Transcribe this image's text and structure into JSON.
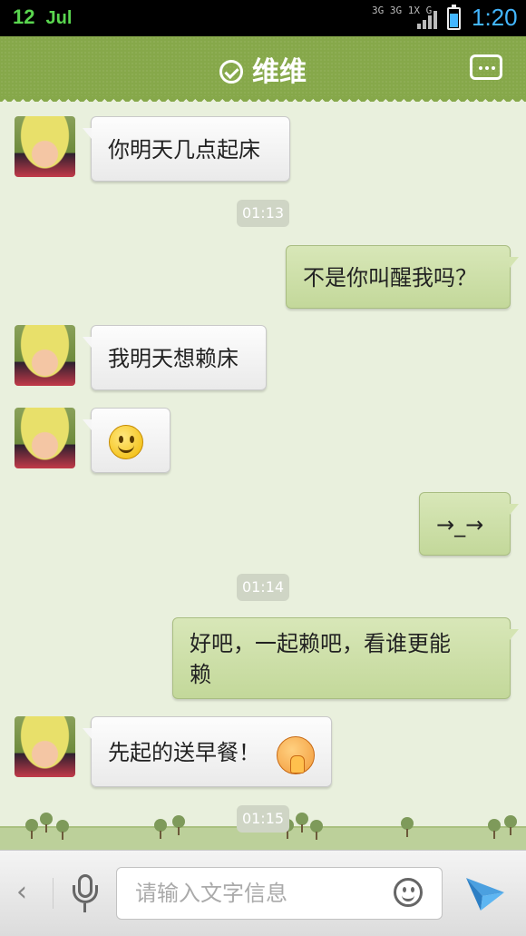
{
  "status_bar": {
    "day": "12",
    "month": "Jul",
    "network_top": "3G 3G 1X G",
    "time": "1:20"
  },
  "header": {
    "contact_name": "维维"
  },
  "messages": [
    {
      "from": "contact",
      "text": "你明天几点起床"
    },
    {
      "timestamp": "01:13"
    },
    {
      "from": "me",
      "text": "不是你叫醒我吗？"
    },
    {
      "from": "contact",
      "text": "我明天想赖床"
    },
    {
      "from": "contact",
      "emoji": "smile-emoji"
    },
    {
      "from": "me",
      "text": "→_→"
    },
    {
      "timestamp": "01:14"
    },
    {
      "from": "me",
      "text": "好吧，一起赖吧，看谁更能",
      "text_line2": "赖"
    },
    {
      "from": "contact",
      "text": "先起的送早餐！",
      "emoji": "praying-emoji"
    },
    {
      "timestamp": "01:15"
    }
  ],
  "input_bar": {
    "placeholder": "请输入文字信息"
  },
  "colors": {
    "header": "#86a84a",
    "background": "#e9f0dd",
    "outgoing_bubble": "#c9dca4",
    "incoming_bubble": "#f4f4f4",
    "accent_blue": "#43b6ff"
  }
}
